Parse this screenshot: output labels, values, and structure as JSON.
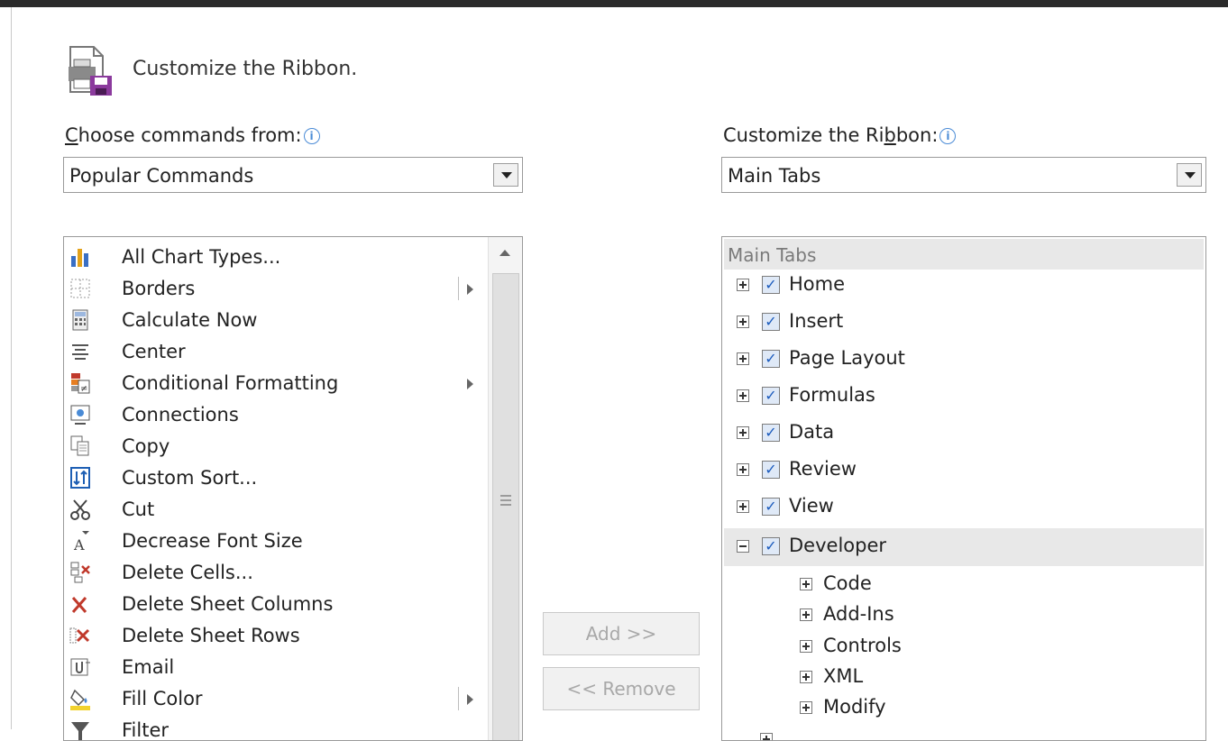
{
  "header": {
    "title": "Customize the Ribbon.",
    "icon": "customize-ribbon-icon"
  },
  "left": {
    "label_prefix": "C",
    "label_rest": "hoose commands from:",
    "dropdown_value": "Popular Commands",
    "commands": [
      {
        "label": "All Chart Types...",
        "icon": "chart-icon"
      },
      {
        "label": "Borders",
        "icon": "borders-icon",
        "submenu": true
      },
      {
        "label": "Calculate Now",
        "icon": "calculator-icon"
      },
      {
        "label": "Center",
        "icon": "center-align-icon"
      },
      {
        "label": "Conditional Formatting",
        "icon": "conditional-formatting-icon",
        "submenu": true
      },
      {
        "label": "Connections",
        "icon": "connections-icon"
      },
      {
        "label": "Copy",
        "icon": "copy-icon"
      },
      {
        "label": "Custom Sort...",
        "icon": "sort-icon"
      },
      {
        "label": "Cut",
        "icon": "scissors-icon"
      },
      {
        "label": "Decrease Font Size",
        "icon": "decrease-font-icon"
      },
      {
        "label": "Delete Cells...",
        "icon": "delete-cells-icon"
      },
      {
        "label": "Delete Sheet Columns",
        "icon": "delete-columns-icon"
      },
      {
        "label": "Delete Sheet Rows",
        "icon": "delete-rows-icon"
      },
      {
        "label": "Email",
        "icon": "email-icon"
      },
      {
        "label": "Fill Color",
        "icon": "fill-color-icon",
        "submenu": true
      },
      {
        "label": "Filter",
        "icon": "filter-icon"
      }
    ]
  },
  "buttons": {
    "add": "Add >>",
    "remove": "<< Remove"
  },
  "right": {
    "label_prefix": "Customize the Ri",
    "label_underline": "b",
    "label_rest": "bon:",
    "dropdown_value": "Main Tabs",
    "group_header": "Main Tabs",
    "tabs": [
      {
        "label": "Home",
        "checked": true
      },
      {
        "label": "Insert",
        "checked": true
      },
      {
        "label": "Page Layout",
        "checked": true
      },
      {
        "label": "Formulas",
        "checked": true
      },
      {
        "label": "Data",
        "checked": true
      },
      {
        "label": "Review",
        "checked": true
      },
      {
        "label": "View",
        "checked": true
      },
      {
        "label": "Developer",
        "checked": true,
        "expanded": true
      }
    ],
    "developer_groups": [
      "Code",
      "Add-Ins",
      "Controls",
      "XML",
      "Modify"
    ]
  }
}
